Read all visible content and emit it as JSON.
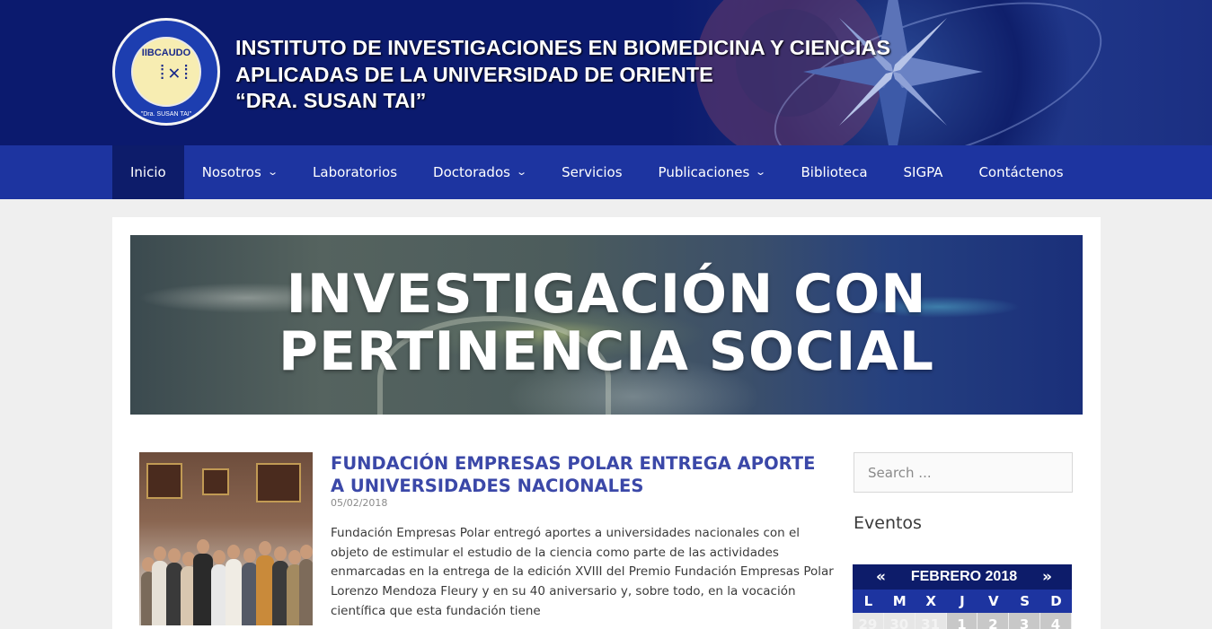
{
  "header": {
    "logo_title": "IIBCAUDO",
    "logo_sub": "\"Dra. SUSAN TAI\"",
    "title_lines": [
      "INSTITUTO DE INVESTIGACIONES EN BIOMEDICINA Y CIENCIAS",
      "APLICADAS DE LA UNIVERSIDAD DE ORIENTE",
      "“DRA. SUSAN TAI”"
    ]
  },
  "nav": {
    "items": [
      {
        "label": "Inicio",
        "dropdown": false,
        "active": true
      },
      {
        "label": "Nosotros",
        "dropdown": true
      },
      {
        "label": "Laboratorios",
        "dropdown": false
      },
      {
        "label": "Doctorados",
        "dropdown": true
      },
      {
        "label": "Servicios",
        "dropdown": false
      },
      {
        "label": "Publicaciones",
        "dropdown": true
      },
      {
        "label": "Biblioteca",
        "dropdown": false
      },
      {
        "label": "SIGPA",
        "dropdown": false
      },
      {
        "label": "Contáctenos",
        "dropdown": false
      }
    ],
    "chevron_icon": "chevron-down-icon"
  },
  "hero": {
    "lines": [
      "INVESTIGACIÓN CON",
      "PERTINENCIA SOCIAL"
    ]
  },
  "post": {
    "title": "FUNDACIÓN EMPRESAS POLAR ENTREGA APORTE A UNIVERSIDADES NACIONALES",
    "date": "05/02/2018",
    "excerpt": "Fundación Empresas Polar entregó aportes a universidades nacionales con el objeto de estimular el estudio de la ciencia como parte de las actividades enmarcadas en la entrega de la edición XVIII del Premio Fundación Empresas Polar Lorenzo Mendoza Fleury y en su 40 aniversario y, sobre todo, en la vocación científica que esta fundación tiene"
  },
  "sidebar": {
    "search_placeholder": "Search ...",
    "events_title": "Eventos",
    "calendar": {
      "prev": "«",
      "next": "»",
      "month": "FEBRERO 2018",
      "weekdays": [
        "L",
        "M",
        "X",
        "J",
        "V",
        "S",
        "D"
      ],
      "first_row": [
        "29",
        "30",
        "31",
        "1",
        "2",
        "3",
        "4"
      ]
    }
  },
  "colors": {
    "header_bg": "#0b1a6e",
    "nav_bg": "#1d34a0",
    "nav_active": "#0d1c6a",
    "post_title": "#3b48a8"
  }
}
